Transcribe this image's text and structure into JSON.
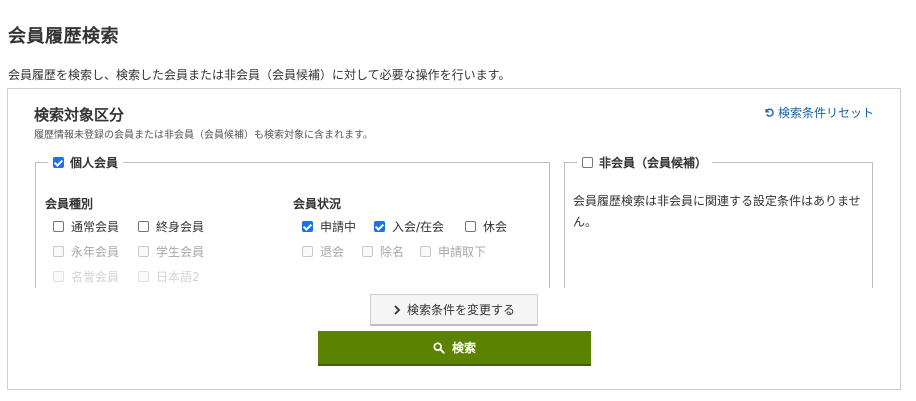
{
  "page": {
    "title": "会員履歴検索",
    "description": "会員履歴を検索し、検索した会員または非会員（会員候補）に対して必要な操作を行います。"
  },
  "panel": {
    "title": "検索対象区分",
    "note": "履歴情報未登録の会員または非会員（会員候補）も検索対象に含まれます。",
    "reset_label": "検索条件リセット",
    "individual": {
      "label": "個人会員",
      "checked": true,
      "member_type": {
        "title": "会員種別",
        "options": [
          {
            "label": "通常会員",
            "checked": false,
            "state": "enabled"
          },
          {
            "label": "終身会員",
            "checked": false,
            "state": "enabled"
          },
          {
            "label": "永年会員",
            "checked": false,
            "state": "disabled"
          },
          {
            "label": "学生会員",
            "checked": false,
            "state": "disabled"
          },
          {
            "label": "名誉会員",
            "checked": false,
            "state": "faded"
          },
          {
            "label": "日本語2",
            "checked": false,
            "state": "faded"
          }
        ]
      },
      "member_status": {
        "title": "会員状況",
        "options": [
          {
            "label": "申請中",
            "checked": true,
            "state": "enabled"
          },
          {
            "label": "入会/在会",
            "checked": true,
            "state": "enabled"
          },
          {
            "label": "休会",
            "checked": false,
            "state": "enabled"
          },
          {
            "label": "退会",
            "checked": false,
            "state": "disabled"
          },
          {
            "label": "除名",
            "checked": false,
            "state": "disabled"
          },
          {
            "label": "申請取下",
            "checked": false,
            "state": "disabled"
          }
        ]
      }
    },
    "nonmember": {
      "label": "非会員（会員候補）",
      "checked": false,
      "message": "会員履歴検索は非会員に関連する設定条件はありません。"
    },
    "change_button_label": "検索条件を変更する",
    "search_button_label": "検索"
  },
  "colors": {
    "search_button": "#5b8200",
    "link": "#1a5fa8",
    "checkbox_checked": "#1a73e8"
  },
  "icons": {
    "reset": "undo-icon",
    "change": "chevron-right-icon",
    "search": "search-icon"
  }
}
